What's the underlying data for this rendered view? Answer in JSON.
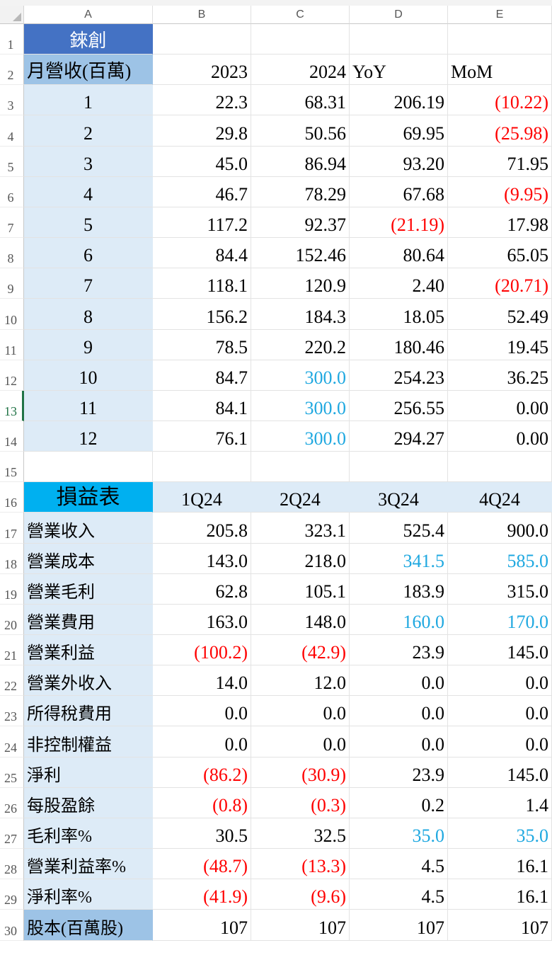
{
  "columns": [
    "A",
    "B",
    "C",
    "D",
    "E"
  ],
  "rows": [
    {
      "n": "1",
      "cells": [
        {
          "v": "錸創",
          "cls": "c",
          "bg": "#4472c4",
          "fc": "#ffffff"
        },
        {
          "v": ""
        },
        {
          "v": ""
        },
        {
          "v": ""
        },
        {
          "v": ""
        }
      ]
    },
    {
      "n": "2",
      "cells": [
        {
          "v": "月營收(百萬)",
          "cls": "l",
          "bg": "#9dc3e6"
        },
        {
          "v": "2023",
          "cls": "r"
        },
        {
          "v": "2024",
          "cls": "r"
        },
        {
          "v": "YoY",
          "cls": "l"
        },
        {
          "v": "MoM",
          "cls": "l"
        }
      ]
    },
    {
      "n": "3",
      "cells": [
        {
          "v": "1",
          "cls": "c",
          "bg": "#ddebf7"
        },
        {
          "v": "22.3",
          "cls": "r"
        },
        {
          "v": "68.31",
          "cls": "r"
        },
        {
          "v": "206.19",
          "cls": "r"
        },
        {
          "v": "(10.22)",
          "cls": "r",
          "col": "red"
        }
      ]
    },
    {
      "n": "4",
      "cells": [
        {
          "v": "2",
          "cls": "c",
          "bg": "#ddebf7"
        },
        {
          "v": "29.8",
          "cls": "r"
        },
        {
          "v": "50.56",
          "cls": "r"
        },
        {
          "v": "69.95",
          "cls": "r"
        },
        {
          "v": "(25.98)",
          "cls": "r",
          "col": "red"
        }
      ]
    },
    {
      "n": "5",
      "cells": [
        {
          "v": "3",
          "cls": "c",
          "bg": "#ddebf7"
        },
        {
          "v": "45.0",
          "cls": "r"
        },
        {
          "v": "86.94",
          "cls": "r"
        },
        {
          "v": "93.20",
          "cls": "r"
        },
        {
          "v": "71.95",
          "cls": "r"
        }
      ]
    },
    {
      "n": "6",
      "cells": [
        {
          "v": "4",
          "cls": "c",
          "bg": "#ddebf7"
        },
        {
          "v": "46.7",
          "cls": "r"
        },
        {
          "v": "78.29",
          "cls": "r"
        },
        {
          "v": "67.68",
          "cls": "r"
        },
        {
          "v": "(9.95)",
          "cls": "r",
          "col": "red"
        }
      ]
    },
    {
      "n": "7",
      "cells": [
        {
          "v": "5",
          "cls": "c",
          "bg": "#ddebf7"
        },
        {
          "v": "117.2",
          "cls": "r"
        },
        {
          "v": "92.37",
          "cls": "r"
        },
        {
          "v": "(21.19)",
          "cls": "r",
          "col": "red"
        },
        {
          "v": "17.98",
          "cls": "r"
        }
      ]
    },
    {
      "n": "8",
      "cells": [
        {
          "v": "6",
          "cls": "c",
          "bg": "#ddebf7"
        },
        {
          "v": "84.4",
          "cls": "r"
        },
        {
          "v": "152.46",
          "cls": "r"
        },
        {
          "v": "80.64",
          "cls": "r"
        },
        {
          "v": "65.05",
          "cls": "r"
        }
      ]
    },
    {
      "n": "9",
      "cells": [
        {
          "v": "7",
          "cls": "c",
          "bg": "#ddebf7"
        },
        {
          "v": "118.1",
          "cls": "r"
        },
        {
          "v": "120.9",
          "cls": "r"
        },
        {
          "v": "2.40",
          "cls": "r"
        },
        {
          "v": "(20.71)",
          "cls": "r",
          "col": "red"
        }
      ]
    },
    {
      "n": "10",
      "cells": [
        {
          "v": "8",
          "cls": "c",
          "bg": "#ddebf7"
        },
        {
          "v": "156.2",
          "cls": "r"
        },
        {
          "v": "184.3",
          "cls": "r"
        },
        {
          "v": "18.05",
          "cls": "r"
        },
        {
          "v": "52.49",
          "cls": "r"
        }
      ]
    },
    {
      "n": "11",
      "cells": [
        {
          "v": "9",
          "cls": "c",
          "bg": "#ddebf7"
        },
        {
          "v": "78.5",
          "cls": "r"
        },
        {
          "v": "220.2",
          "cls": "r"
        },
        {
          "v": "180.46",
          "cls": "r"
        },
        {
          "v": "19.45",
          "cls": "r"
        }
      ]
    },
    {
      "n": "12",
      "cells": [
        {
          "v": "10",
          "cls": "c",
          "bg": "#ddebf7"
        },
        {
          "v": "84.7",
          "cls": "r"
        },
        {
          "v": "300.0",
          "cls": "r",
          "col": "blue"
        },
        {
          "v": "254.23",
          "cls": "r"
        },
        {
          "v": "36.25",
          "cls": "r"
        }
      ]
    },
    {
      "n": "13",
      "sel": true,
      "cells": [
        {
          "v": "11",
          "cls": "c",
          "bg": "#ddebf7"
        },
        {
          "v": "84.1",
          "cls": "r"
        },
        {
          "v": "300.0",
          "cls": "r",
          "col": "blue"
        },
        {
          "v": "256.55",
          "cls": "r"
        },
        {
          "v": "0.00",
          "cls": "r"
        }
      ]
    },
    {
      "n": "14",
      "cells": [
        {
          "v": "12",
          "cls": "c",
          "bg": "#ddebf7"
        },
        {
          "v": "76.1",
          "cls": "r"
        },
        {
          "v": "300.0",
          "cls": "r",
          "col": "blue"
        },
        {
          "v": "294.27",
          "cls": "r"
        },
        {
          "v": "0.00",
          "cls": "r"
        }
      ]
    },
    {
      "n": "15",
      "cells": [
        {
          "v": ""
        },
        {
          "v": ""
        },
        {
          "v": ""
        },
        {
          "v": ""
        },
        {
          "v": ""
        }
      ]
    },
    {
      "n": "16",
      "cells": [
        {
          "v": "損益表",
          "cls": "c",
          "bg": "#00b0f0",
          "big": true
        },
        {
          "v": "1Q24",
          "cls": "c",
          "bg": "#ddebf7"
        },
        {
          "v": "2Q24",
          "cls": "c",
          "bg": "#ddebf7"
        },
        {
          "v": "3Q24",
          "cls": "c",
          "bg": "#ddebf7"
        },
        {
          "v": "4Q24",
          "cls": "c",
          "bg": "#ddebf7"
        }
      ]
    },
    {
      "n": "17",
      "cells": [
        {
          "v": "營業收入",
          "cls": "l lbl",
          "bg": "#ddebf7"
        },
        {
          "v": "205.8",
          "cls": "r"
        },
        {
          "v": "323.1",
          "cls": "r"
        },
        {
          "v": "525.4",
          "cls": "r"
        },
        {
          "v": "900.0",
          "cls": "r"
        }
      ]
    },
    {
      "n": "18",
      "cells": [
        {
          "v": "營業成本",
          "cls": "l lbl",
          "bg": "#ddebf7"
        },
        {
          "v": "143.0",
          "cls": "r"
        },
        {
          "v": "218.0",
          "cls": "r"
        },
        {
          "v": "341.5",
          "cls": "r",
          "col": "blue"
        },
        {
          "v": "585.0",
          "cls": "r",
          "col": "blue"
        }
      ]
    },
    {
      "n": "19",
      "cells": [
        {
          "v": "營業毛利",
          "cls": "l lbl",
          "bg": "#ddebf7"
        },
        {
          "v": "62.8",
          "cls": "r"
        },
        {
          "v": "105.1",
          "cls": "r"
        },
        {
          "v": "183.9",
          "cls": "r"
        },
        {
          "v": "315.0",
          "cls": "r"
        }
      ]
    },
    {
      "n": "20",
      "cells": [
        {
          "v": "營業費用",
          "cls": "l lbl",
          "bg": "#ddebf7"
        },
        {
          "v": "163.0",
          "cls": "r"
        },
        {
          "v": "148.0",
          "cls": "r"
        },
        {
          "v": "160.0",
          "cls": "r",
          "col": "blue"
        },
        {
          "v": "170.0",
          "cls": "r",
          "col": "blue"
        }
      ]
    },
    {
      "n": "21",
      "cells": [
        {
          "v": "營業利益",
          "cls": "l lbl",
          "bg": "#ddebf7"
        },
        {
          "v": "(100.2)",
          "cls": "r",
          "col": "red"
        },
        {
          "v": "(42.9)",
          "cls": "r",
          "col": "red"
        },
        {
          "v": "23.9",
          "cls": "r"
        },
        {
          "v": "145.0",
          "cls": "r"
        }
      ]
    },
    {
      "n": "22",
      "cells": [
        {
          "v": "營業外收入",
          "cls": "l lbl",
          "bg": "#ddebf7"
        },
        {
          "v": "14.0",
          "cls": "r"
        },
        {
          "v": "12.0",
          "cls": "r"
        },
        {
          "v": "0.0",
          "cls": "r"
        },
        {
          "v": "0.0",
          "cls": "r"
        }
      ]
    },
    {
      "n": "23",
      "cells": [
        {
          "v": "所得稅費用",
          "cls": "l lbl",
          "bg": "#ddebf7"
        },
        {
          "v": "0.0",
          "cls": "r"
        },
        {
          "v": "0.0",
          "cls": "r"
        },
        {
          "v": "0.0",
          "cls": "r"
        },
        {
          "v": "0.0",
          "cls": "r"
        }
      ]
    },
    {
      "n": "24",
      "cells": [
        {
          "v": "非控制權益",
          "cls": "l lbl",
          "bg": "#ddebf7"
        },
        {
          "v": "0.0",
          "cls": "r"
        },
        {
          "v": "0.0",
          "cls": "r"
        },
        {
          "v": "0.0",
          "cls": "r"
        },
        {
          "v": "0.0",
          "cls": "r"
        }
      ]
    },
    {
      "n": "25",
      "cells": [
        {
          "v": "淨利",
          "cls": "l lbl",
          "bg": "#ddebf7"
        },
        {
          "v": "(86.2)",
          "cls": "r",
          "col": "red"
        },
        {
          "v": "(30.9)",
          "cls": "r",
          "col": "red"
        },
        {
          "v": "23.9",
          "cls": "r"
        },
        {
          "v": "145.0",
          "cls": "r"
        }
      ]
    },
    {
      "n": "26",
      "cells": [
        {
          "v": "每股盈餘",
          "cls": "l lbl",
          "bg": "#ddebf7"
        },
        {
          "v": "(0.8)",
          "cls": "r",
          "col": "red"
        },
        {
          "v": "(0.3)",
          "cls": "r",
          "col": "red"
        },
        {
          "v": "0.2",
          "cls": "r"
        },
        {
          "v": "1.4",
          "cls": "r"
        }
      ]
    },
    {
      "n": "27",
      "cells": [
        {
          "v": "毛利率%",
          "cls": "l lbl",
          "bg": "#ddebf7"
        },
        {
          "v": "30.5",
          "cls": "r"
        },
        {
          "v": "32.5",
          "cls": "r"
        },
        {
          "v": "35.0",
          "cls": "r",
          "col": "blue"
        },
        {
          "v": "35.0",
          "cls": "r",
          "col": "blue"
        }
      ]
    },
    {
      "n": "28",
      "cells": [
        {
          "v": "營業利益率%",
          "cls": "l lbl",
          "bg": "#ddebf7"
        },
        {
          "v": "(48.7)",
          "cls": "r",
          "col": "red"
        },
        {
          "v": "(13.3)",
          "cls": "r",
          "col": "red"
        },
        {
          "v": "4.5",
          "cls": "r"
        },
        {
          "v": "16.1",
          "cls": "r"
        }
      ]
    },
    {
      "n": "29",
      "cells": [
        {
          "v": "淨利率%",
          "cls": "l lbl",
          "bg": "#ddebf7"
        },
        {
          "v": "(41.9)",
          "cls": "r",
          "col": "red"
        },
        {
          "v": "(9.6)",
          "cls": "r",
          "col": "red"
        },
        {
          "v": "4.5",
          "cls": "r"
        },
        {
          "v": "16.1",
          "cls": "r"
        }
      ]
    },
    {
      "n": "30",
      "cells": [
        {
          "v": "股本(百萬股)",
          "cls": "l lbl",
          "bg": "#9dc3e6"
        },
        {
          "v": "107",
          "cls": "r"
        },
        {
          "v": "107",
          "cls": "r"
        },
        {
          "v": "107",
          "cls": "r"
        },
        {
          "v": "107",
          "cls": "r"
        }
      ]
    }
  ]
}
